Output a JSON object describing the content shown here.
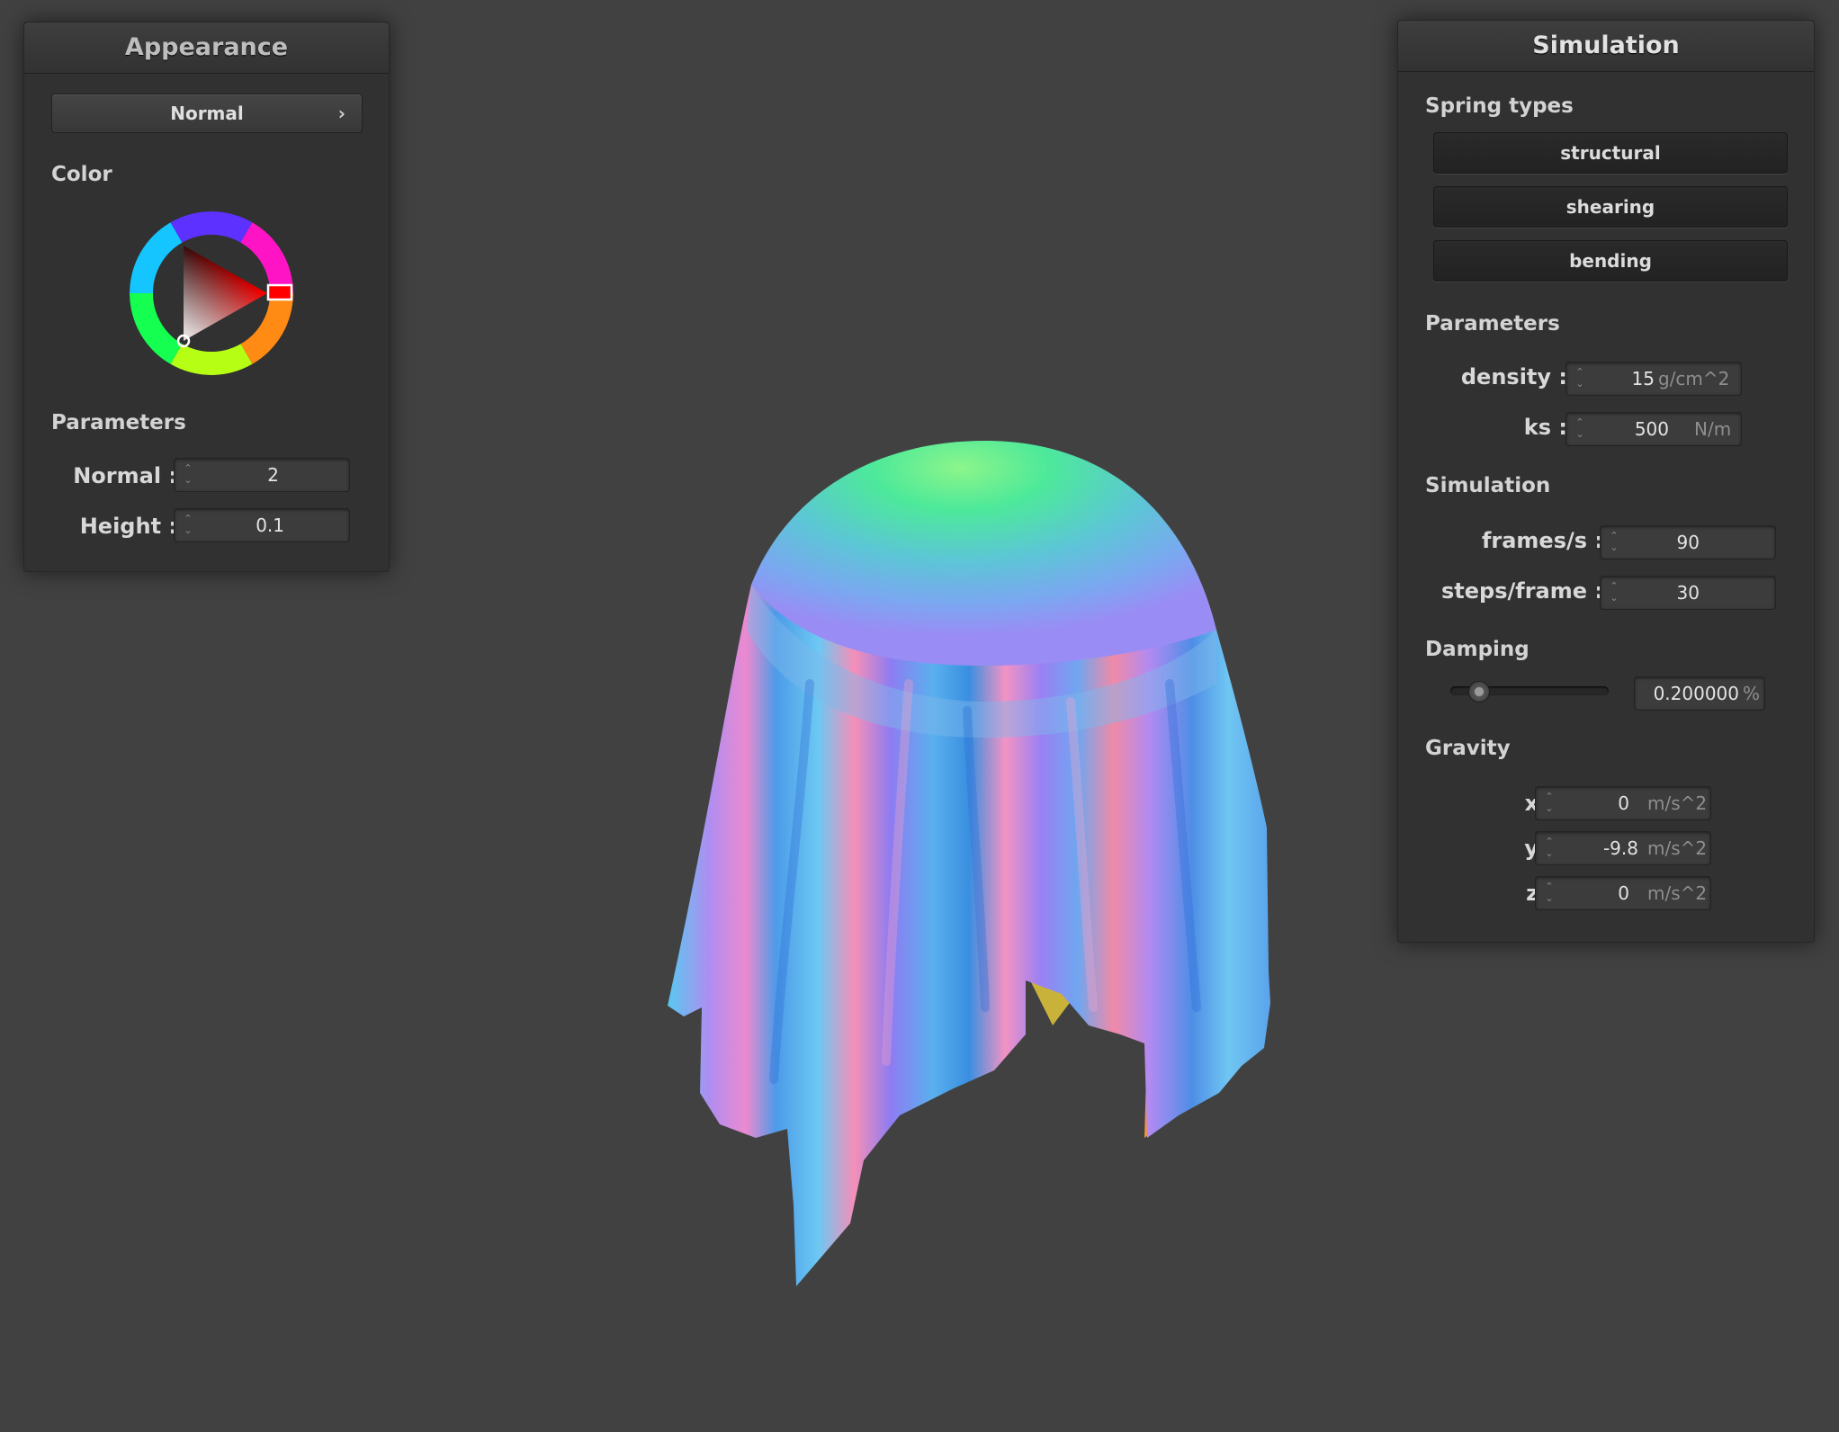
{
  "viewport": {
    "model": "cloth-draped-over-sphere",
    "shading": "normal-map"
  },
  "appearance": {
    "title": "Appearance",
    "shader_dropdown": "Normal",
    "color_label": "Color",
    "selected_color": "#ff0000",
    "parameters_label": "Parameters",
    "normal_label": "Normal :",
    "normal_value": "2",
    "height_label": "Height :",
    "height_value": "0.1"
  },
  "simulation": {
    "title": "Simulation",
    "spring_types_label": "Spring types",
    "springs": [
      "structural",
      "shearing",
      "bending"
    ],
    "parameters_label": "Parameters",
    "density_label": "density :",
    "density_value": "15",
    "density_unit": "g/cm^2",
    "ks_label": "ks :",
    "ks_value": "500",
    "ks_unit": "N/m",
    "simulation_label": "Simulation",
    "fps_label": "frames/s :",
    "fps_value": "90",
    "steps_label": "steps/frame :",
    "steps_value": "30",
    "damping_label": "Damping",
    "damping_value": "0.200000",
    "damping_unit": "%",
    "damping_level": 0.2,
    "gravity_label": "Gravity",
    "gx_label": "x :",
    "gx_value": "0",
    "gy_label": "y :",
    "gy_value": "-9.8",
    "gz_label": "z :",
    "gz_value": "0",
    "gravity_unit": "m/s^2"
  }
}
